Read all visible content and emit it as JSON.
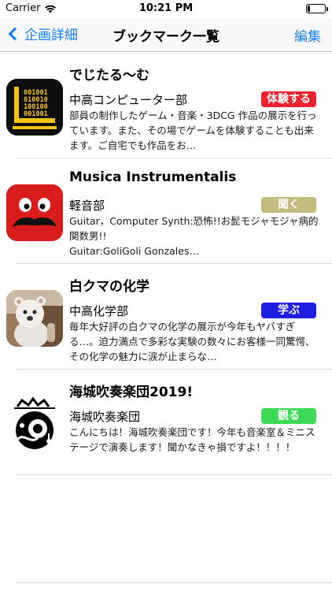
{
  "status_bar": {
    "carrier": "Carrier",
    "time": "10:21 PM",
    "battery_level": 0.15
  },
  "nav": {
    "back_label": "企画詳細",
    "title": "ブックマーク一覧",
    "edit_label": "編集"
  },
  "colors": {
    "accent": "#157efb",
    "badge_red": "#e8232d",
    "badge_khaki": "#c4bc7c",
    "badge_blue": "#1d1ee0",
    "badge_green": "#3ed957"
  },
  "items": [
    {
      "title": "でじたる〜む",
      "org": "中高コンピューター部",
      "badge": "体験する",
      "badge_color": "#e8232d",
      "description": "部員の制作したゲーム・音楽・3DCG 作品の展示を行っています。また、その場でゲームを体験することも出来ます。ご自宅でも作品をお…",
      "icon": "binary-computer-icon",
      "icon_text": [
        "001001",
        "010010",
        "100100",
        "001001"
      ]
    },
    {
      "title": "Musica Instrumentalis",
      "org": "軽音部",
      "badge": "聞く",
      "badge_color": "#c4bc7c",
      "description": "Guitar，Computer Synth:恐怖!!お髭モジャモジャ病的関数男!!\nGuitar:GoliGoli Gonzales…",
      "icon": "mustache-face-icon"
    },
    {
      "title": "白クマの化学",
      "org": "中高化学部",
      "badge": "学ぶ",
      "badge_color": "#1d1ee0",
      "description": "毎年大好評の白クマの化学の展示が今年もヤバすぎる…。迫力満点で多彩な実験の数々にお客様一同驚愕、その化学の魅力に涙が止まらな…",
      "icon": "polar-bear-photo-icon"
    },
    {
      "title": "海城吹奏楽団2019!",
      "org": "海城吹奏楽団",
      "badge": "観る",
      "badge_color": "#3ed957",
      "description": "こんにちは！海城吹奏楽団です！今年も音楽室＆ミニステージで演奏します！聞かなきゃ損ですよ！！！！",
      "icon": "brass-band-icon"
    }
  ]
}
